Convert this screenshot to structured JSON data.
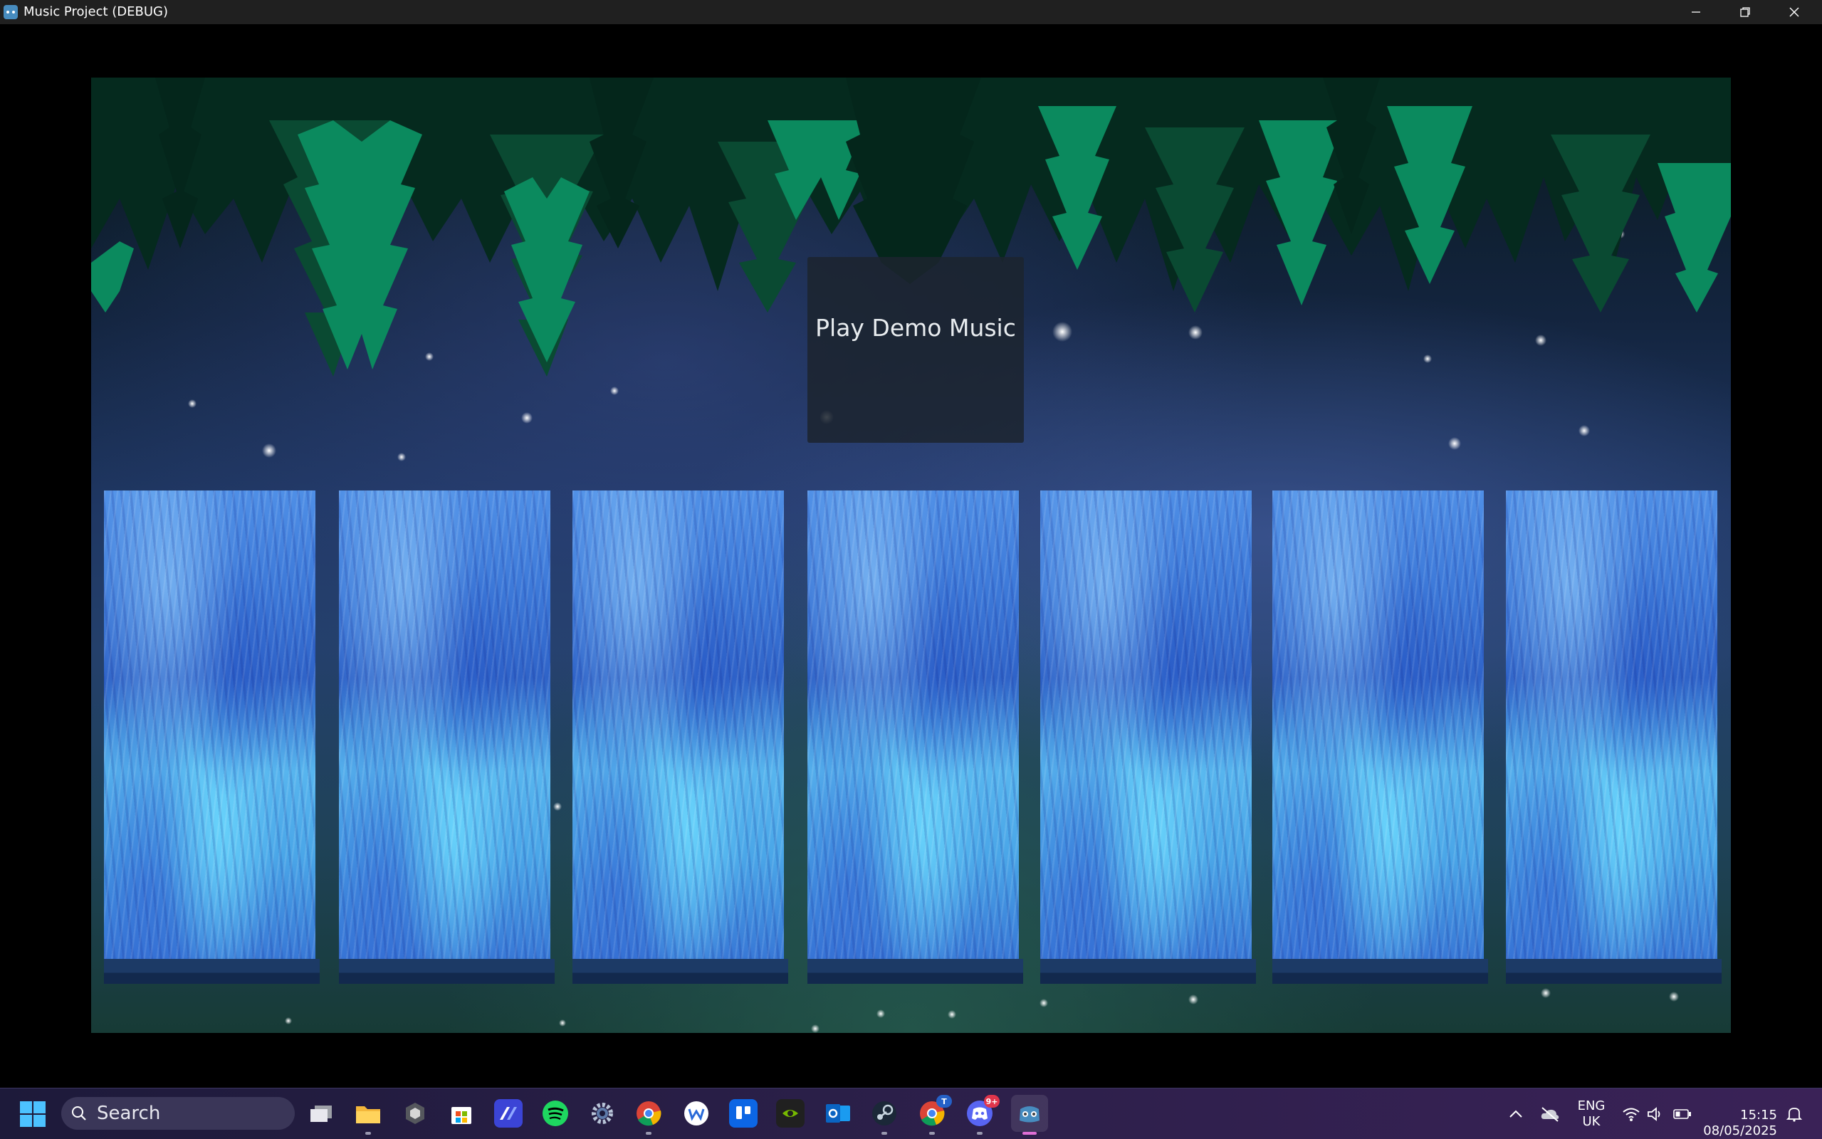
{
  "window": {
    "title": "Music Project (DEBUG)",
    "controls": [
      "minimize",
      "restore",
      "close"
    ]
  },
  "game": {
    "play_button_label": "Play Demo Music",
    "waterfalls": [
      {
        "id": 1
      },
      {
        "id": 2
      },
      {
        "id": 3
      },
      {
        "id": 4
      },
      {
        "id": 5
      },
      {
        "id": 6
      },
      {
        "id": 7
      }
    ],
    "colors": {
      "tree_dark": "#062a1f",
      "tree_light": "#0b8a5e",
      "water": "#4aa6e8",
      "button_bg": "#1c242e"
    }
  },
  "taskbar": {
    "search_placeholder": "Search",
    "apps": [
      {
        "name": "task-view",
        "icon": "task-view-icon"
      },
      {
        "name": "file-explorer",
        "icon": "folder-icon"
      },
      {
        "name": "app",
        "icon": "hex-app-icon"
      },
      {
        "name": "microsoft-store",
        "icon": "store-icon"
      },
      {
        "name": "app",
        "icon": "code-app-icon"
      },
      {
        "name": "spotify",
        "icon": "spotify-icon"
      },
      {
        "name": "settings",
        "icon": "gear-icon"
      },
      {
        "name": "chrome",
        "icon": "chrome-icon"
      },
      {
        "name": "app",
        "icon": "w-app-icon"
      },
      {
        "name": "trello",
        "icon": "trello-icon"
      },
      {
        "name": "nvidia",
        "icon": "nvidia-icon"
      },
      {
        "name": "outlook",
        "icon": "outlook-icon"
      },
      {
        "name": "steam",
        "icon": "steam-icon"
      },
      {
        "name": "chrome",
        "icon": "chrome-icon",
        "badge": "T"
      },
      {
        "name": "discord",
        "icon": "discord-icon",
        "badge": "9+"
      },
      {
        "name": "godot",
        "icon": "godot-icon",
        "active": true
      }
    ],
    "tray": {
      "language_line1": "ENG",
      "language_line2": "UK",
      "time": "15:15",
      "date": "08/05/2025"
    }
  }
}
